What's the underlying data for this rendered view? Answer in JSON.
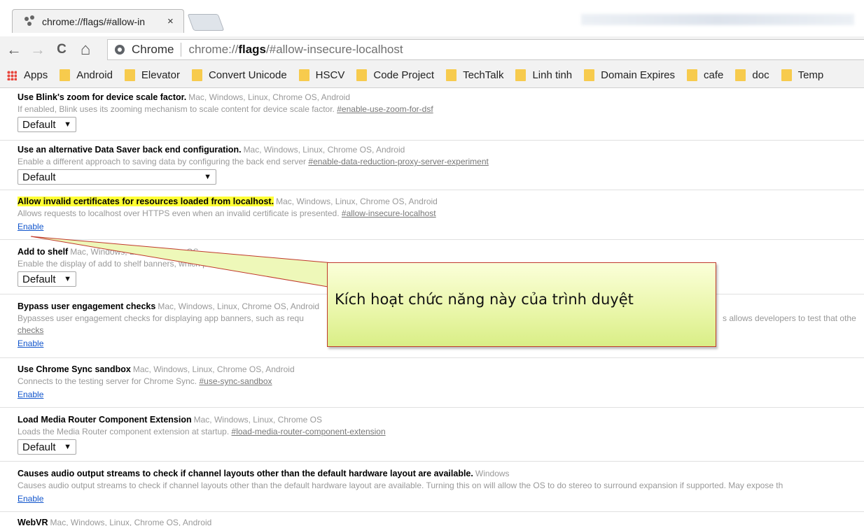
{
  "tab": {
    "title": "chrome://flags/#allow-in",
    "close_glyph": "×"
  },
  "toolbar": {
    "back_glyph": "←",
    "forward_glyph": "→",
    "reload_glyph": "C",
    "home_glyph": "⌂"
  },
  "omnibox": {
    "chip_label": "Chrome",
    "url_prefix": "chrome://",
    "url_strong": "flags",
    "url_suffix": "/#allow-insecure-localhost"
  },
  "bookmarks": {
    "apps_label": "Apps",
    "items": [
      "Android",
      "Elevator",
      "Convert Unicode",
      "HSCV",
      "Code Project",
      "TechTalk",
      "Linh tinh",
      "Domain Expires",
      "cafe",
      "doc",
      "Temp"
    ]
  },
  "flags": [
    {
      "name": "Use Blink's zoom for device scale factor.",
      "platforms": "Mac, Windows, Linux, Chrome OS, Android",
      "desc": "If enabled, Blink uses its zooming mechanism to scale content for device scale factor.",
      "anchor": "#enable-use-zoom-for-dsf",
      "control": "select",
      "value": "Default"
    },
    {
      "name": "Use an alternative Data Saver back end configuration.",
      "platforms": "Mac, Windows, Linux, Chrome OS, Android",
      "desc": "Enable a different approach to saving data by configuring the back end server",
      "anchor": "#enable-data-reduction-proxy-server-experiment",
      "control": "select",
      "value": "Default"
    },
    {
      "name": "Allow invalid certificates for resources loaded from localhost.",
      "platforms": "Mac, Windows, Linux, Chrome OS, Android",
      "desc": "Allows requests to localhost over HTTPS even when an invalid certificate is presented.",
      "anchor": "#allow-insecure-localhost",
      "control": "link",
      "value": "Enable",
      "highlighted": true
    },
    {
      "name": "Add to shelf",
      "platforms": "Mac, Windows, Linux, Chrome OS",
      "desc": "Enable the display of add to shelf banners, which prompt a user to add a we",
      "anchor": "",
      "control": "select",
      "value": "Default"
    },
    {
      "name": "Bypass user engagement checks",
      "platforms": "Mac, Windows, Linux, Chrome OS, Android",
      "desc": "Bypasses user engagement checks for displaying app banners, such as requ",
      "desc_right": "s allows developers to test that othe",
      "desc_line2": "checks",
      "anchor": "",
      "control": "link",
      "value": "Enable"
    },
    {
      "name": "Use Chrome Sync sandbox",
      "platforms": "Mac, Windows, Linux, Chrome OS, Android",
      "desc": "Connects to the testing server for Chrome Sync.",
      "anchor": "#use-sync-sandbox",
      "control": "link",
      "value": "Enable"
    },
    {
      "name": "Load Media Router Component Extension",
      "platforms": "Mac, Windows, Linux, Chrome OS",
      "desc": "Loads the Media Router component extension at startup.",
      "anchor": "#load-media-router-component-extension",
      "control": "select",
      "value": "Default"
    },
    {
      "name": "Causes audio output streams to check if channel layouts other than the default hardware layout are available.",
      "platforms": "Windows",
      "desc": "Causes audio output streams to check if channel layouts other than the default hardware layout are available. Turning this on will allow the OS to do stereo to surround expansion if supported. May expose th",
      "anchor": "",
      "control": "link",
      "value": "Enable"
    },
    {
      "name": "WebVR",
      "platforms": "Mac, Windows, Linux, Chrome OS, Android",
      "desc": "",
      "anchor": "",
      "control": "none",
      "value": ""
    }
  ],
  "callout": {
    "text": "Kích hoạt chức năng này của trình duyệt"
  },
  "colors": {
    "highlight": "#ffff33",
    "link": "#1155cc",
    "callout_border": "#c0392b"
  }
}
